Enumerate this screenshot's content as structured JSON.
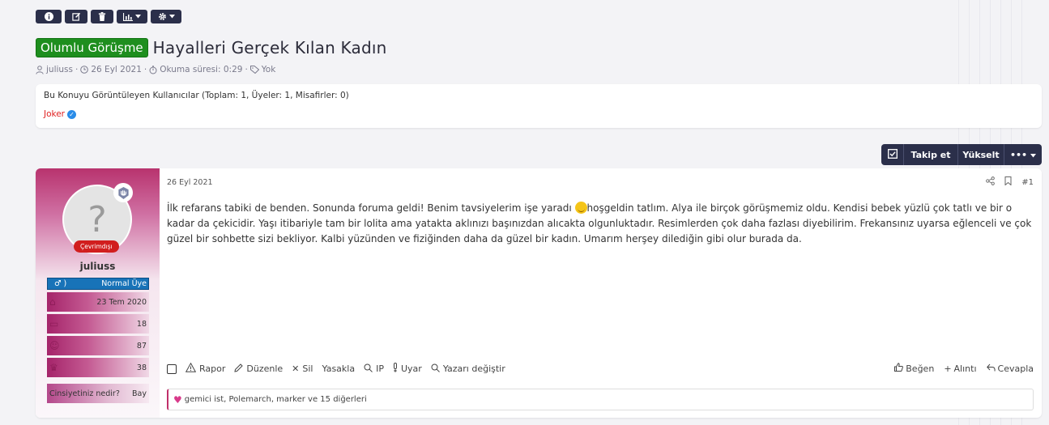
{
  "moderation": {
    "buttons": [
      {
        "name": "info-button",
        "icon": "info-icon"
      },
      {
        "name": "edit-thread-button",
        "icon": "edit-icon"
      },
      {
        "name": "delete-button",
        "icon": "trash-icon"
      },
      {
        "name": "stats-button",
        "icon": "chart-icon"
      },
      {
        "name": "settings-button",
        "icon": "gear-icon"
      }
    ]
  },
  "thread": {
    "prefix": "Olumlu Görüşme",
    "prefix_color": "#1e8e1e",
    "title": "Hayalleri Gerçek Kılan Kadın",
    "author": "juliuss",
    "date": "26 Eyl 2021",
    "read_time": "Okuma süresi: 0:29",
    "tags": "Yok",
    "separator": "·"
  },
  "viewers": {
    "text": "Bu Konuyu Görüntüleyen Kullanıcılar (Toplam: 1, Üyeler: 1, Misafirler: 0)",
    "users": [
      "Joker"
    ]
  },
  "thread_actions": {
    "follow": "Takip et",
    "bump": "Yükselt",
    "more": "•••"
  },
  "post": {
    "date": "26 Eyl 2021",
    "number": "#1",
    "body_part1": "İlk refarans tabiki de benden. Sonunda foruma geldi! Benim tavsiyelerim işe yaradı ",
    "body_part2": "hoşgeldin tatlım. Alya ile birçok görüşmemiz oldu. Kendisi bebek yüzlü çok tatlı ve bir o kadar da çekicidir. Yaşı itibariyle tam bir lolita ama yatakta aklınızı başınızdan alıcakta olgunluktadır. Resimlerden çok daha fazlası diyebilirim. Frekansınız uyarsa eğlenceli ve çok güzel bir sohbette sizi bekliyor. Kalbi yüzünden ve fiziğinden daha da güzel bir kadın. Umarım herşey dilediğin gibi olur burada da.",
    "emoji": "smile-emoji"
  },
  "user": {
    "avatar_letter": "?",
    "status": "Çevrimdışı",
    "name": "juliuss",
    "gender_symbol": "♂ )",
    "rank": "Normal Üye",
    "rank_color": "#1873b8",
    "joined": "23 Tem 2020",
    "messages": "18",
    "reactions": "87",
    "points": "38",
    "gender_q": "Cinsiyetiniz nedir?",
    "gender_a": "Bay"
  },
  "post_tools": {
    "report": "Rapor",
    "edit": "Düzenle",
    "delete": "Sil",
    "ban": "Yasakla",
    "ip": "IP",
    "warn": "Uyar",
    "change_author": "Yazarı değiştir"
  },
  "reactions": {
    "like": "Beğen",
    "quote": "Alıntı",
    "reply": "Cevapla"
  },
  "likes_text": "gemici ist, Polemarch, marker ve 15 diğerleri"
}
